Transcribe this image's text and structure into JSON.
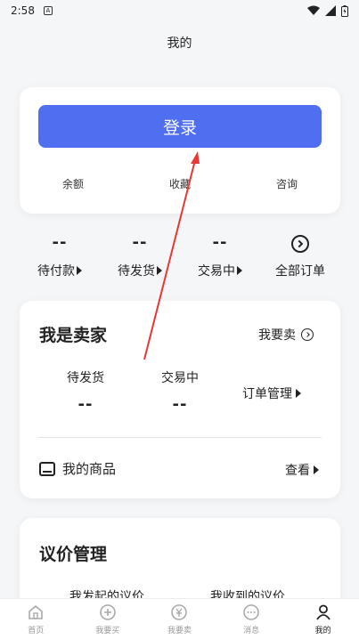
{
  "status_bar": {
    "time": "2:58",
    "badge": "A"
  },
  "page": {
    "title": "我的"
  },
  "login_card": {
    "login_label": "登录",
    "links": [
      "余额",
      "收藏",
      "咨询"
    ]
  },
  "orders": [
    {
      "count": "--",
      "label": "待付款"
    },
    {
      "count": "--",
      "label": "待发货"
    },
    {
      "count": "--",
      "label": "交易中"
    },
    {
      "label": "全部订单"
    }
  ],
  "seller": {
    "title": "我是卖家",
    "sell_link": "我要卖",
    "stats": [
      {
        "label": "待发货",
        "value": "--"
      },
      {
        "label": "交易中",
        "value": "--"
      }
    ],
    "order_mgmt": "订单管理",
    "goods_label": "我的商品",
    "view_label": "查看"
  },
  "bargain": {
    "title": "议价管理",
    "initiated": "我发起的议价",
    "received": "我收到的议价"
  },
  "tabbar": [
    {
      "label": "首页",
      "icon": "home-icon"
    },
    {
      "label": "我要买",
      "icon": "plus-circle-icon"
    },
    {
      "label": "我要卖",
      "icon": "sell-icon"
    },
    {
      "label": "消息",
      "icon": "message-icon"
    },
    {
      "label": "我的",
      "icon": "user-icon",
      "active": true
    }
  ],
  "colors": {
    "primary": "#4f6ef0",
    "annotation_arrow": "#e53935"
  }
}
